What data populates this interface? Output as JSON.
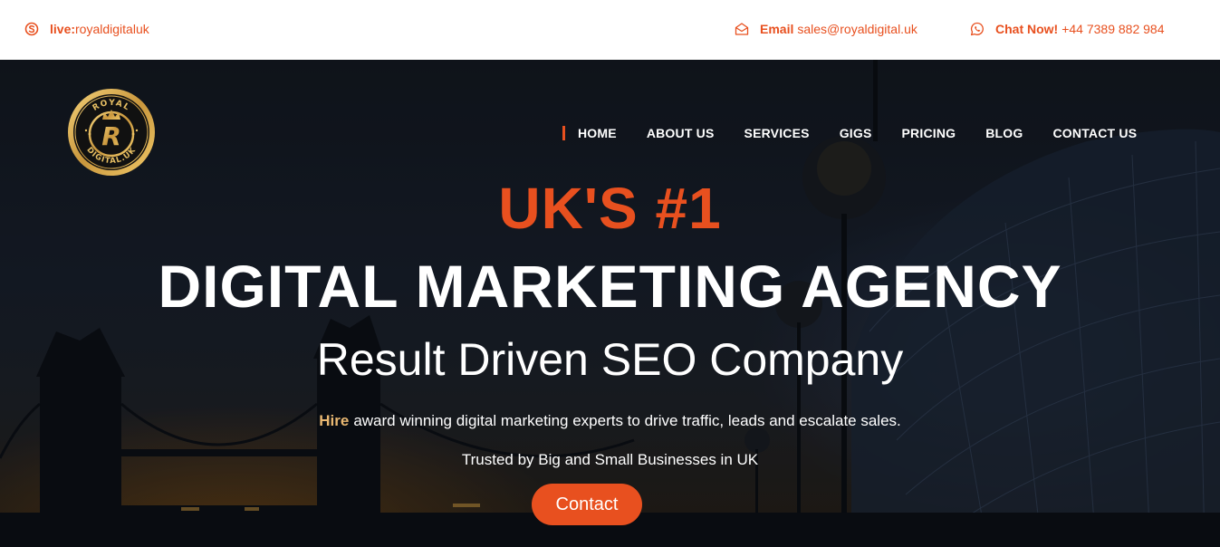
{
  "topbar": {
    "skype": {
      "icon": "skype-icon",
      "label": "live:",
      "value": "royaldigitaluk"
    },
    "email": {
      "icon": "envelope-icon",
      "label": "Email",
      "value": "sales@royaldigital.uk"
    },
    "chat": {
      "icon": "whatsapp-icon",
      "label": "Chat Now!",
      "value": "+44 7389 882 984"
    }
  },
  "logo": {
    "top_text": "ROYAL",
    "monogram": "R",
    "bottom_text": "DIGITAL.UK"
  },
  "nav": {
    "items": [
      {
        "label": "HOME",
        "active": true
      },
      {
        "label": "ABOUT US"
      },
      {
        "label": "SERVICES"
      },
      {
        "label": "GIGS"
      },
      {
        "label": "PRICING"
      },
      {
        "label": "BLOG"
      },
      {
        "label": "CONTACT US"
      }
    ]
  },
  "hero": {
    "headline_1": "UK'S #1",
    "headline_2": "DIGITAL MARKETING AGENCY",
    "subheading": "Result Driven SEO Company",
    "tagline_highlight": "Hire",
    "tagline_rest": "award winning digital marketing experts to drive traffic, leads and escalate sales.",
    "trust_line": "Trusted by Big and Small Businesses in UK",
    "cta_label": "Contact"
  },
  "colors": {
    "accent": "#e8501f",
    "highlight": "#e9b872",
    "gold": "#c9a04a",
    "topbar_bg": "#ffffff"
  }
}
